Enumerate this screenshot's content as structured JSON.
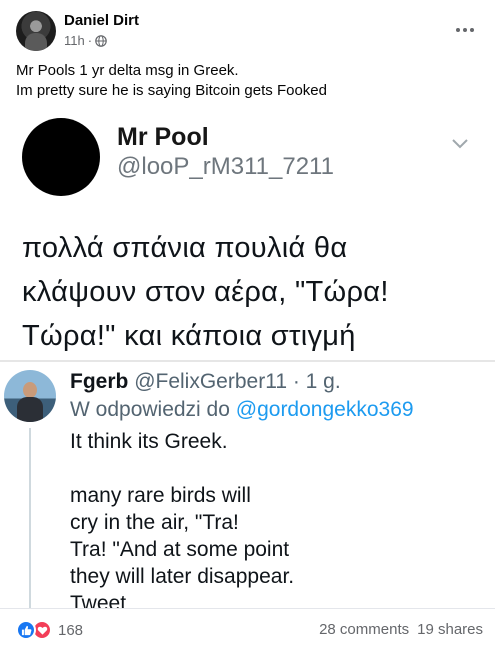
{
  "post": {
    "author": "Daniel Dirt",
    "time": "11h",
    "separator": "·",
    "privacy_icon": "globe-icon",
    "text_line1": "Mr Pools 1 yr delta msg in Greek.",
    "text_line2": "Im pretty sure he is saying Bitcoin gets Fooked"
  },
  "tweet1": {
    "name": "Mr Pool",
    "handle": "@looP_rM311_7211",
    "body_line1": "πολλά σπάνια πουλιά θα",
    "body_line2": "κλάψουν στον αέρα, \"Τώρα!",
    "body_line3": "Τώρα!\" και κάποια στιγμή"
  },
  "tweet2": {
    "name": "Fgerb",
    "handle_time": "@FelixGerber11 · 1 g.",
    "reply_prefix": "W odpowiedzi do",
    "reply_mention": "@gordongekko369",
    "body": "It think its Greek.\n\nmany rare birds will\n cry in the air, \"Tra!\n Tra! \"And at some point\n they will later disappear.\n Tweet"
  },
  "footer": {
    "reaction_count": "168",
    "comments": "28 comments",
    "shares": "19 shares"
  },
  "colors": {
    "like": "#1877f2",
    "love": "#f33e58",
    "link_blue": "#1d9bf0",
    "meta_gray": "#65676b"
  }
}
